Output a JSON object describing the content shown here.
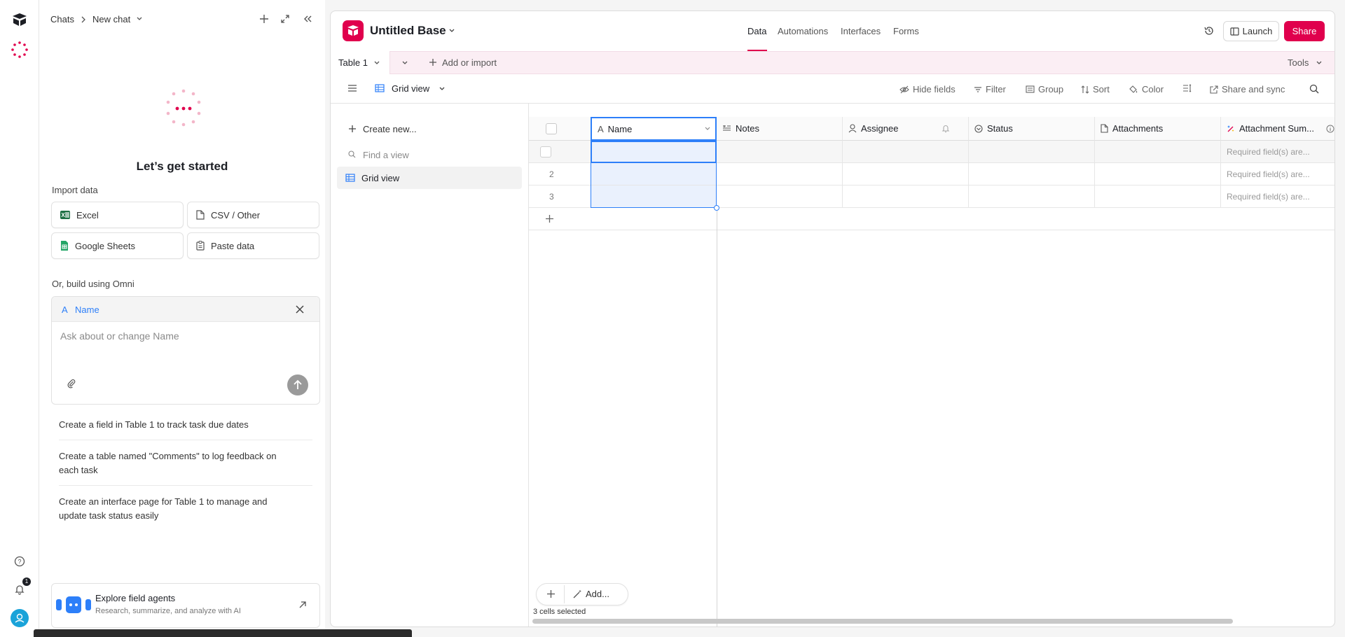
{
  "rail": {
    "icons": [
      "airtable-logo-icon",
      "omni-spinner-icon",
      "help-icon",
      "notification-bell-icon",
      "user-avatar-icon"
    ],
    "notification_count": "1"
  },
  "chat": {
    "breadcrumb_root": "Chats",
    "breadcrumb_current": "New chat",
    "heading": "Let’s get started",
    "import_label": "Import data",
    "import_buttons": [
      "Excel",
      "CSV / Other",
      "Google Sheets",
      "Paste data"
    ],
    "build_label": "Or, build using Omni",
    "context_field": "Name",
    "prompt_placeholder": "Ask about or change Name",
    "suggestions": [
      "Create a field in Table 1 to track task due dates",
      "Create a table named \"Comments\" to log feedback on each task",
      "Create an interface page for Table 1 to manage and update task status easily"
    ],
    "explore_title": "Explore field agents",
    "explore_subtitle": "Research, summarize, and analyze with AI"
  },
  "base": {
    "title": "Untitled Base",
    "nav_tabs": [
      "Data",
      "Automations",
      "Interfaces",
      "Forms"
    ],
    "active_tab": "Data",
    "launch_label": "Launch",
    "share_label": "Share",
    "table_tab": "Table 1",
    "add_import_label": "Add or import",
    "tools_label": "Tools",
    "view_name": "Grid view",
    "toolbar": [
      "Hide fields",
      "Filter",
      "Group",
      "Sort",
      "Color",
      "Share and sync"
    ],
    "sidebar": {
      "create_new": "Create new...",
      "find_view_placeholder": "Find a view",
      "views": [
        "Grid view"
      ]
    },
    "columns": [
      "Name",
      "Notes",
      "Assignee",
      "Status",
      "Attachments",
      "Attachment Sum..."
    ],
    "rows": [
      {
        "num": "",
        "attachment_summary": "Required field(s) are..."
      },
      {
        "num": "2",
        "attachment_summary": "Required field(s) are..."
      },
      {
        "num": "3",
        "attachment_summary": "Required field(s) are..."
      }
    ],
    "add_label": "Add...",
    "status_text": "3 cells selected"
  },
  "colors": {
    "brand_red": "#e0004d",
    "accent_blue": "#2d7ff9",
    "selected_fill": "#eaf1fd",
    "pink_bar": "#fbeef4"
  }
}
